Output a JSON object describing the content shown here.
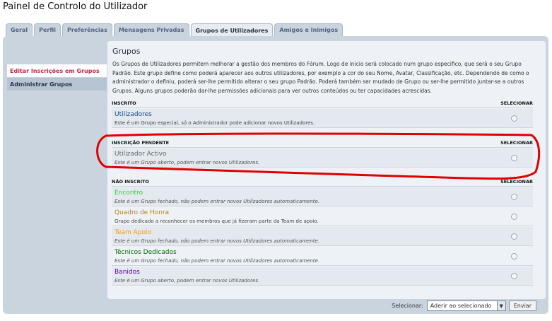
{
  "page_title": "Painel de Controlo do Utilizador",
  "tabs": [
    "Geral",
    "Perfil",
    "Preferências",
    "Mensagens Privadas",
    "Grupos de Utilizadores",
    "Amigos e Inimigos"
  ],
  "active_tab": "Grupos de Utilizadores",
  "sidebar": {
    "items": [
      {
        "label": "Editar Inscrições em Grupos"
      },
      {
        "label": "Administrar Grupos"
      }
    ]
  },
  "main": {
    "title": "Grupos",
    "intro": "Os Grupos de Utilizadores permitem melhorar a gestão dos membros do Fórum. Logo de inicio será colocado num grupo especifico, que será o seu Grupo Padrão. Este grupo define como poderá aparecer aos outros utilizadores, por exemplo a cor do seu Nome, Avatar, Classificação, etc. Dependendo de como o administrador o definiu, poderá ser-lhe permitido alterar o seu grupo Padrão. Poderá também ser mudado de Grupo ou ser-lhe permitido juntar-se a outros Grupos. Alguns grupos poderão dar-lhe permissões adicionais para ver outros conteúdos ou ter capacidades acrescidas.",
    "sections": [
      {
        "header": "INSCRITO",
        "select_label": "SELECIONAR",
        "groups": [
          {
            "name": "Utilizadores",
            "desc": "Este é um Grupo especial, só o Administrador pode adicionar novos Utilizadores.",
            "color": "#1a4a8a"
          }
        ]
      },
      {
        "header": "INSCRIÇÃO PENDENTE",
        "select_label": "SELECIONAR",
        "groups": [
          {
            "name": "Utilizador Activo",
            "desc": "Este é um Grupo aberto, podem entrar novos Utilizadores.",
            "color": "#666666"
          }
        ]
      },
      {
        "header": "NÃO INSCRITO",
        "select_label": "SELECIONAR",
        "groups": [
          {
            "name": "Encontro",
            "desc": "Este é um Grupo fechado, não podem entrar novos Utilizadores automaticamente.",
            "color": "#33cc33"
          },
          {
            "name": "Quadro de Honra",
            "desc": "Grupo dedicado a reconhecer os membros que já fizeram parte da Team de apoio.",
            "color": "#b8860b"
          },
          {
            "name": "Team Apoio",
            "desc": "Este é um Grupo fechado, não podem entrar novos Utilizadores automaticamente.",
            "color": "#ff9900"
          },
          {
            "name": "Técnicos Dedicados",
            "desc": "Este é um Grupo fechado, não podem entrar novos Utilizadores automaticamente.",
            "color": "#006600"
          },
          {
            "name": "Banidos",
            "desc": "Este é um Grupo aberto, podem entrar novos Utilizadores.",
            "color": "#660099"
          }
        ]
      }
    ]
  },
  "footer": {
    "select_label": "Selecionar:",
    "select_value": "Aderir ao selecionado",
    "submit_label": "Enviar"
  },
  "colors": {
    "annotation": "#e00000",
    "active_sidebar": "#bc2a4d"
  }
}
